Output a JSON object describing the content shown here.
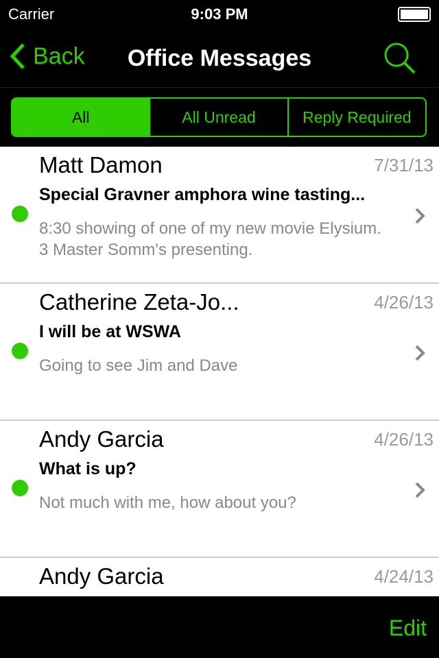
{
  "status": {
    "carrier": "Carrier",
    "time": "9:03 PM"
  },
  "nav": {
    "back": "Back",
    "title": "Office Messages"
  },
  "segments": [
    "All",
    "All Unread",
    "Reply Required"
  ],
  "messages": [
    {
      "name": "Matt Damon",
      "date": "7/31/13",
      "subject": "Special Gravner amphora wine tasting...",
      "preview": "8:30 showing of one of my new movie Elysium.  3 Master Somm's presenting.",
      "unread": true
    },
    {
      "name": "Catherine Zeta-Jo...",
      "date": "4/26/13",
      "subject": "I will be at WSWA",
      "preview": "Going to see Jim and Dave",
      "unread": true
    },
    {
      "name": "Andy Garcia",
      "date": "4/26/13",
      "subject": "What is up?",
      "preview": "Not much with me, how about you?",
      "unread": true
    },
    {
      "name": "Andy Garcia",
      "date": "4/24/13",
      "subject": "",
      "preview": "",
      "unread": false
    }
  ],
  "toolbar": {
    "edit": "Edit"
  },
  "colors": {
    "accent": "#2ecc00"
  }
}
